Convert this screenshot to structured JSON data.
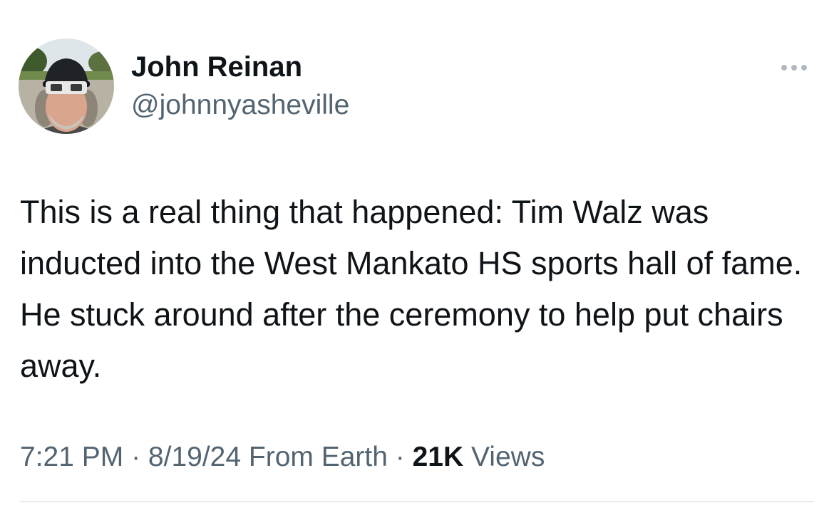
{
  "tweet": {
    "author": {
      "name": "John Reinan",
      "handle": "@johnnyasheville",
      "avatar_icon": "profile-photo"
    },
    "more_icon": "ellipsis-icon",
    "text": "This is a real thing that happened: Tim Walz was inducted into the West Mankato HS sports hall of fame. He stuck around after the ceremony to help put chairs away.",
    "time": "7:21 PM",
    "separator": " · ",
    "date": "8/19/24",
    "source": "From Earth",
    "views_count": "21K",
    "views_label": "Views"
  },
  "colors": {
    "text_primary": "#0f1419",
    "text_secondary": "#536471",
    "divider": "#cfd9de"
  }
}
